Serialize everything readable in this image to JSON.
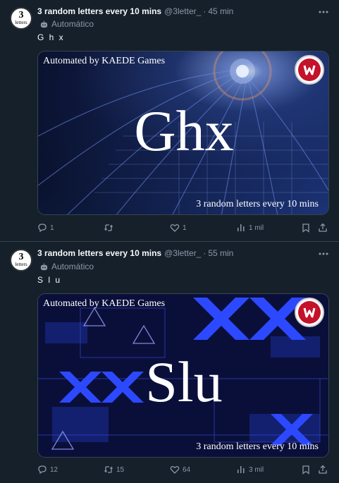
{
  "tweets": [
    {
      "name": "3 random letters every 10 mins",
      "handle": "@3letter_",
      "dot": "·",
      "time": "45 min",
      "automated": "Automático",
      "text": "G h x",
      "avatar": {
        "num": "3",
        "word": "letters"
      },
      "card": {
        "credit": "Automated by KAEDE Games",
        "big": "Ghx",
        "tag": "3 random letters every 10 mins",
        "theme": "blue-light-tunnel"
      },
      "actions": {
        "replies": "1",
        "retweets": "",
        "likes": "1",
        "views": "1 mil"
      }
    },
    {
      "name": "3 random letters every 10 mins",
      "handle": "@3letter_",
      "dot": "·",
      "time": "55 min",
      "automated": "Automático",
      "text": "S l u",
      "avatar": {
        "num": "3",
        "word": "letters"
      },
      "card": {
        "credit": "Automated by KAEDE Games",
        "big": "Slu",
        "tag": "3 random letters every 10 mins",
        "theme": "blue-warning-x"
      },
      "actions": {
        "replies": "12",
        "retweets": "15",
        "likes": "64",
        "views": "3 mil"
      }
    }
  ],
  "colors": {
    "bg": "#15202b",
    "text": "#f7f9f9",
    "muted": "#8b98a5",
    "border": "#38444d",
    "logo_red": "#c4122a"
  }
}
